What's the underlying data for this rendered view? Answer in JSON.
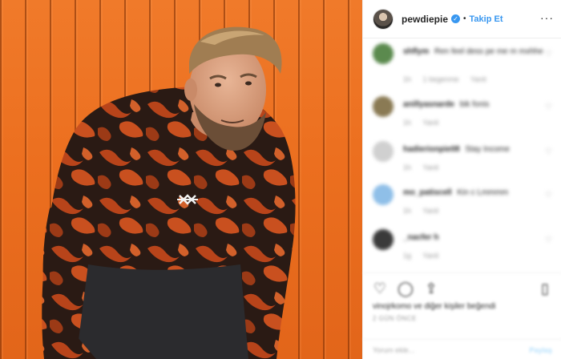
{
  "post": {
    "username": "pewdiepie",
    "follow_label": "Takip Et",
    "separator": "•",
    "more_glyph": "···"
  },
  "comments": [
    {
      "user": "shflym",
      "text": "Ren feel dess pe me m mxhhe",
      "meta": [
        "1h",
        "1 begenme",
        "Yanit"
      ],
      "avatar_color": "#5b8a4e"
    },
    {
      "user": "anillyasnarde",
      "text": "bik fonis",
      "meta": [
        "1h",
        "Yanit"
      ],
      "avatar_color": "#8a7a54"
    },
    {
      "user": "hadierionpie08",
      "text": "Stay Income",
      "meta": [
        "1h",
        "Yanit"
      ],
      "avatar_color": "#d0d0d0"
    },
    {
      "user": "mo_patiscell",
      "text": "Kin c Lmmmm",
      "meta": [
        "1h",
        "Yanit"
      ],
      "avatar_color": "#8fbfe8"
    },
    {
      "user": "_nacfer h",
      "text": "",
      "meta": [
        "1g",
        "Yanit"
      ],
      "avatar_color": "#3a3a3a"
    }
  ],
  "actions": {
    "like_icon": "heart-icon",
    "comment_icon": "comment-icon",
    "share_icon": "share-icon",
    "save_icon": "bookmark-icon"
  },
  "likes": {
    "text": "vinojrkomo ve diğer kişiler beğendi",
    "time": "2 GÜN ÖNCE"
  },
  "add_comment": {
    "placeholder": "Yorum ekle...",
    "post_label": "Paylaş"
  },
  "colors": {
    "accent": "#3897f0",
    "wall": "#ec6f1f",
    "sweater_dark": "#2a1a14",
    "sweater_rust": "#b8441a"
  }
}
